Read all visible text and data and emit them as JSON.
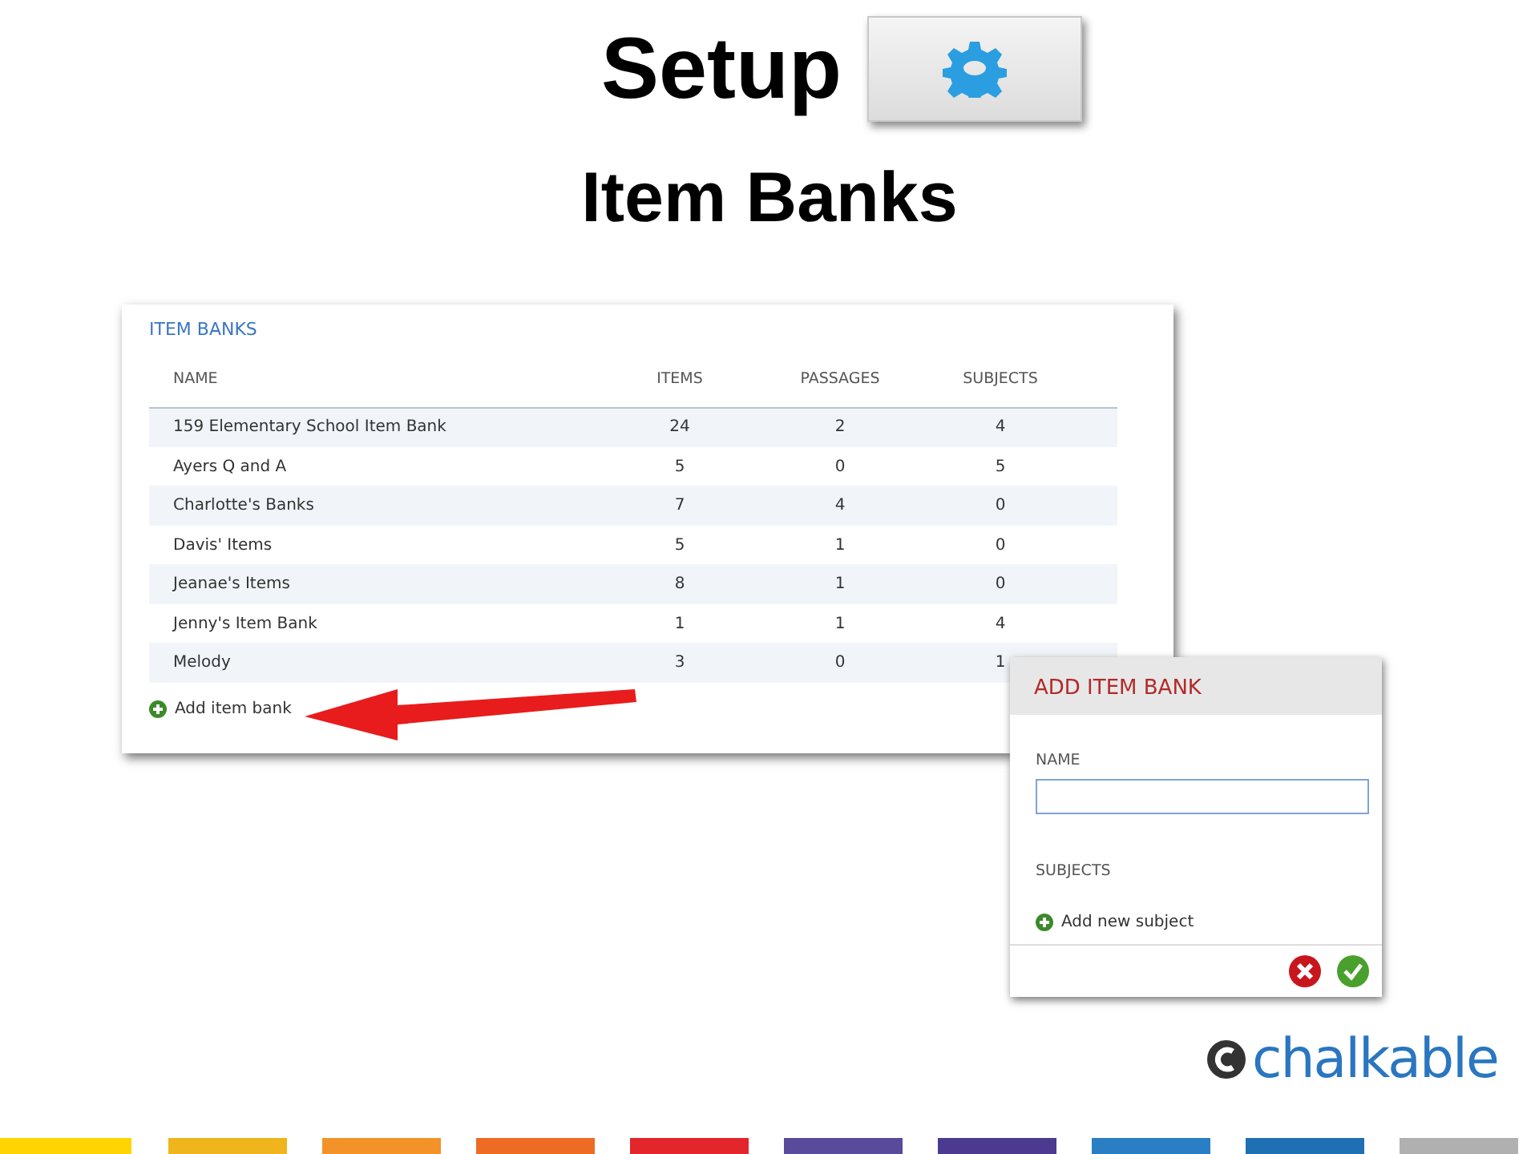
{
  "slide": {
    "title": "Setup",
    "subtitle": "Item Banks"
  },
  "item_banks": {
    "heading": "ITEM BANKS",
    "columns": [
      "NAME",
      "ITEMS",
      "PASSAGES",
      "SUBJECTS"
    ],
    "rows": [
      [
        "159 Elementary School Item Bank",
        "24",
        "2",
        "4"
      ],
      [
        "Ayers Q and A",
        "5",
        "0",
        "5"
      ],
      [
        "Charlotte's Banks",
        "7",
        "4",
        "0"
      ],
      [
        "Davis' Items",
        "5",
        "1",
        "0"
      ],
      [
        "Jeanae's Items",
        "8",
        "1",
        "0"
      ],
      [
        "Jenny's Item Bank",
        "1",
        "1",
        "4"
      ],
      [
        "Melody",
        "3",
        "0",
        "1"
      ]
    ],
    "add_link": "Add item bank"
  },
  "dialog": {
    "title": "ADD ITEM BANK",
    "name_label": "NAME",
    "subjects_label": "SUBJECTS",
    "add_subject": "Add new subject"
  },
  "logo": {
    "text": "chalkable"
  }
}
